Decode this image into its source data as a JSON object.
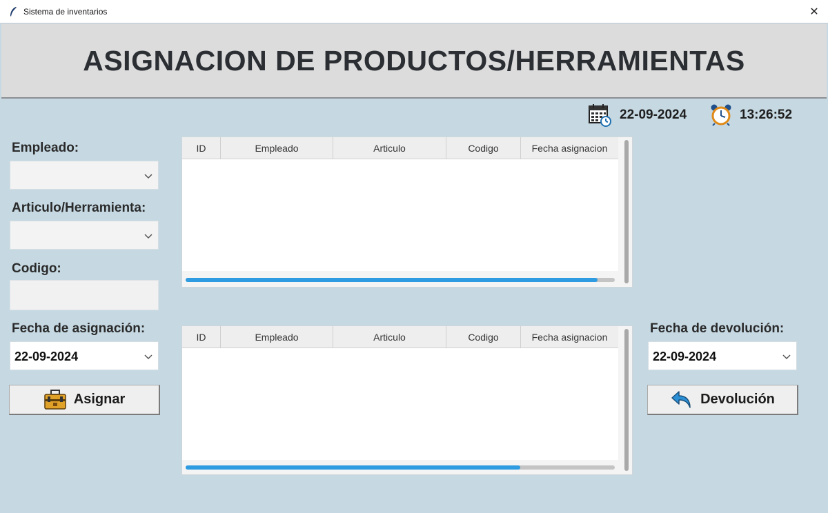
{
  "window": {
    "title": "Sistema de inventarios",
    "close_glyph": "✕"
  },
  "header": {
    "title": "ASIGNACION DE PRODUCTOS/HERRAMIENTAS"
  },
  "status": {
    "date": "22-09-2024",
    "time": "13:26:52"
  },
  "form": {
    "empleado_label": "Empleado:",
    "empleado_value": "",
    "articulo_label": "Articulo/Herramienta:",
    "articulo_value": "",
    "codigo_label": "Codigo:",
    "codigo_value": "",
    "fecha_asignacion_label": "Fecha de asignación:",
    "fecha_asignacion_value": "22-09-2024",
    "asignar_label": "Asignar"
  },
  "return_panel": {
    "fecha_devolucion_label": "Fecha de devolución:",
    "fecha_devolucion_value": "22-09-2024",
    "devolucion_label": "Devolución"
  },
  "tables": {
    "columns": [
      "ID",
      "Empleado",
      "Articulo",
      "Codigo",
      "Fecha asignacion"
    ],
    "top_rows": [],
    "bottom_rows": [],
    "top_scroll_fraction": 0.96,
    "bottom_scroll_fraction": 0.78
  },
  "icons": {
    "app": "feather-icon",
    "calendar": "calendar-clock-icon",
    "clock": "alarm-clock-icon",
    "asignar": "toolbox-icon",
    "devolucion": "return-arrow-icon"
  },
  "colors": {
    "background": "#c6d9e3",
    "header_bg": "#dcdcdc",
    "scroll_accent": "#2f9be0"
  }
}
